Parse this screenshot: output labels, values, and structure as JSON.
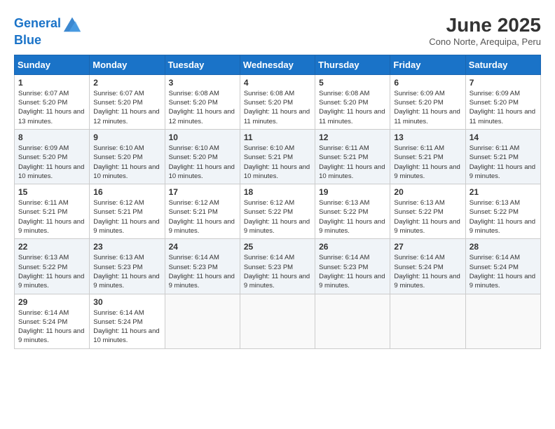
{
  "header": {
    "logo_line1": "General",
    "logo_line2": "Blue",
    "month": "June 2025",
    "location": "Cono Norte, Arequipa, Peru"
  },
  "days_of_week": [
    "Sunday",
    "Monday",
    "Tuesday",
    "Wednesday",
    "Thursday",
    "Friday",
    "Saturday"
  ],
  "weeks": [
    [
      {
        "day": "1",
        "sunrise": "6:07 AM",
        "sunset": "5:20 PM",
        "daylight": "11 hours and 13 minutes."
      },
      {
        "day": "2",
        "sunrise": "6:07 AM",
        "sunset": "5:20 PM",
        "daylight": "11 hours and 12 minutes."
      },
      {
        "day": "3",
        "sunrise": "6:08 AM",
        "sunset": "5:20 PM",
        "daylight": "11 hours and 12 minutes."
      },
      {
        "day": "4",
        "sunrise": "6:08 AM",
        "sunset": "5:20 PM",
        "daylight": "11 hours and 11 minutes."
      },
      {
        "day": "5",
        "sunrise": "6:08 AM",
        "sunset": "5:20 PM",
        "daylight": "11 hours and 11 minutes."
      },
      {
        "day": "6",
        "sunrise": "6:09 AM",
        "sunset": "5:20 PM",
        "daylight": "11 hours and 11 minutes."
      },
      {
        "day": "7",
        "sunrise": "6:09 AM",
        "sunset": "5:20 PM",
        "daylight": "11 hours and 11 minutes."
      }
    ],
    [
      {
        "day": "8",
        "sunrise": "6:09 AM",
        "sunset": "5:20 PM",
        "daylight": "11 hours and 10 minutes."
      },
      {
        "day": "9",
        "sunrise": "6:10 AM",
        "sunset": "5:20 PM",
        "daylight": "11 hours and 10 minutes."
      },
      {
        "day": "10",
        "sunrise": "6:10 AM",
        "sunset": "5:20 PM",
        "daylight": "11 hours and 10 minutes."
      },
      {
        "day": "11",
        "sunrise": "6:10 AM",
        "sunset": "5:21 PM",
        "daylight": "11 hours and 10 minutes."
      },
      {
        "day": "12",
        "sunrise": "6:11 AM",
        "sunset": "5:21 PM",
        "daylight": "11 hours and 10 minutes."
      },
      {
        "day": "13",
        "sunrise": "6:11 AM",
        "sunset": "5:21 PM",
        "daylight": "11 hours and 9 minutes."
      },
      {
        "day": "14",
        "sunrise": "6:11 AM",
        "sunset": "5:21 PM",
        "daylight": "11 hours and 9 minutes."
      }
    ],
    [
      {
        "day": "15",
        "sunrise": "6:11 AM",
        "sunset": "5:21 PM",
        "daylight": "11 hours and 9 minutes."
      },
      {
        "day": "16",
        "sunrise": "6:12 AM",
        "sunset": "5:21 PM",
        "daylight": "11 hours and 9 minutes."
      },
      {
        "day": "17",
        "sunrise": "6:12 AM",
        "sunset": "5:21 PM",
        "daylight": "11 hours and 9 minutes."
      },
      {
        "day": "18",
        "sunrise": "6:12 AM",
        "sunset": "5:22 PM",
        "daylight": "11 hours and 9 minutes."
      },
      {
        "day": "19",
        "sunrise": "6:13 AM",
        "sunset": "5:22 PM",
        "daylight": "11 hours and 9 minutes."
      },
      {
        "day": "20",
        "sunrise": "6:13 AM",
        "sunset": "5:22 PM",
        "daylight": "11 hours and 9 minutes."
      },
      {
        "day": "21",
        "sunrise": "6:13 AM",
        "sunset": "5:22 PM",
        "daylight": "11 hours and 9 minutes."
      }
    ],
    [
      {
        "day": "22",
        "sunrise": "6:13 AM",
        "sunset": "5:22 PM",
        "daylight": "11 hours and 9 minutes."
      },
      {
        "day": "23",
        "sunrise": "6:13 AM",
        "sunset": "5:23 PM",
        "daylight": "11 hours and 9 minutes."
      },
      {
        "day": "24",
        "sunrise": "6:14 AM",
        "sunset": "5:23 PM",
        "daylight": "11 hours and 9 minutes."
      },
      {
        "day": "25",
        "sunrise": "6:14 AM",
        "sunset": "5:23 PM",
        "daylight": "11 hours and 9 minutes."
      },
      {
        "day": "26",
        "sunrise": "6:14 AM",
        "sunset": "5:23 PM",
        "daylight": "11 hours and 9 minutes."
      },
      {
        "day": "27",
        "sunrise": "6:14 AM",
        "sunset": "5:24 PM",
        "daylight": "11 hours and 9 minutes."
      },
      {
        "day": "28",
        "sunrise": "6:14 AM",
        "sunset": "5:24 PM",
        "daylight": "11 hours and 9 minutes."
      }
    ],
    [
      {
        "day": "29",
        "sunrise": "6:14 AM",
        "sunset": "5:24 PM",
        "daylight": "11 hours and 9 minutes."
      },
      {
        "day": "30",
        "sunrise": "6:14 AM",
        "sunset": "5:24 PM",
        "daylight": "11 hours and 10 minutes."
      },
      null,
      null,
      null,
      null,
      null
    ]
  ]
}
